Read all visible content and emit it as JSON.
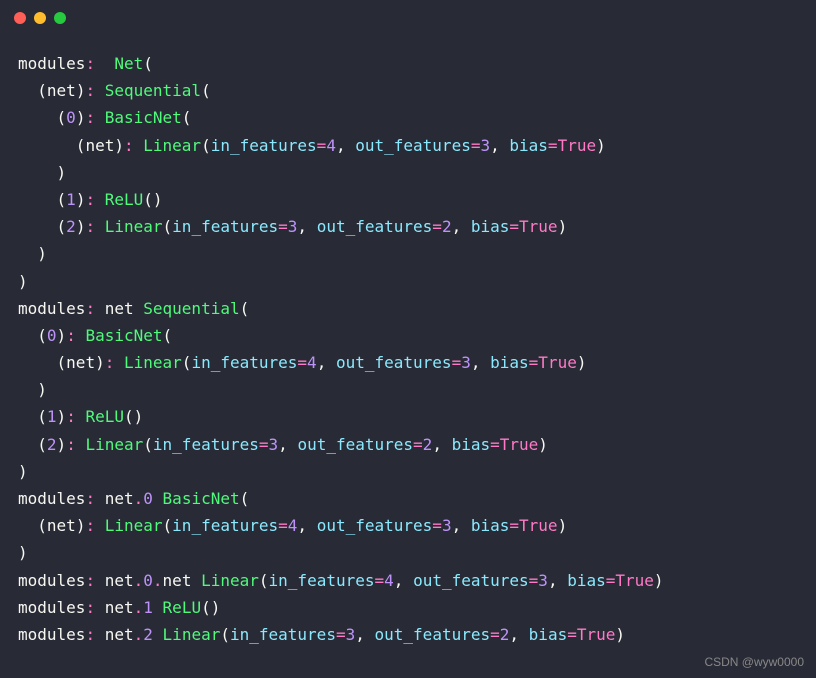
{
  "titlebar": {
    "dots": [
      "red",
      "yellow",
      "green"
    ]
  },
  "tokens": {
    "modules": "modules",
    "colon": ":",
    "net_class": "Net",
    "lparen": "(",
    "rparen": ")",
    "net_attr": "net",
    "sequential": "Sequential",
    "idx0": "0",
    "idx1": "1",
    "idx2": "2",
    "basicnet": "BasicNet",
    "linear": "Linear",
    "relu": "ReLU",
    "in_features": "in_features",
    "out_features": "out_features",
    "bias": "bias",
    "eq": "=",
    "comma": ",",
    "dot": ".",
    "four": "4",
    "three": "3",
    "two": "2",
    "true": "True"
  },
  "watermark": "CSDN @wyw0000"
}
